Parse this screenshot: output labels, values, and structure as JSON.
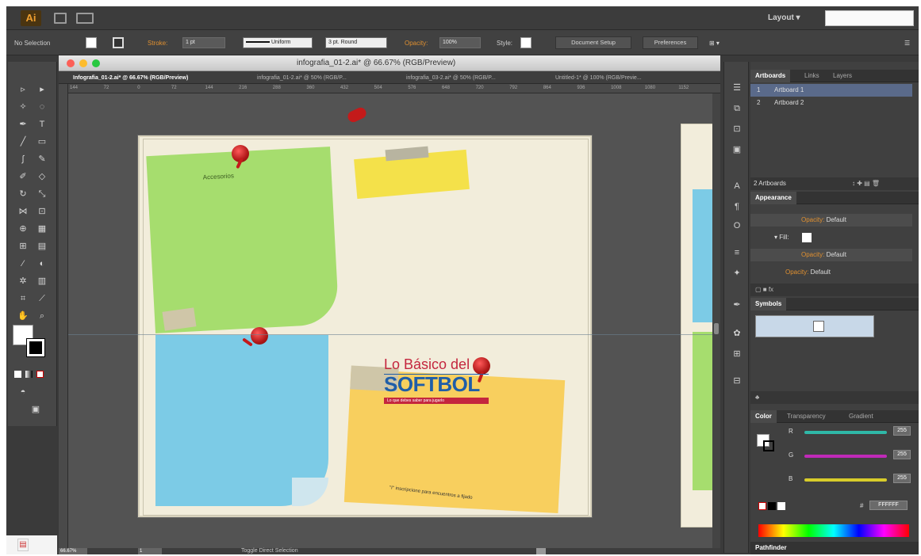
{
  "app": {
    "logo": "Ai",
    "workspace": "Layout"
  },
  "control_bar": {
    "selection": "No Selection",
    "stroke_label": "Stroke:",
    "stroke_weight": "1 pt",
    "stroke_profile": "Uniform",
    "brush": "3 pt. Round",
    "opacity_label": "Opacity:",
    "opacity_value": "100%",
    "style_label": "Style:",
    "document_setup": "Document Setup",
    "preferences": "Preferences"
  },
  "document": {
    "title": "infografia_01-2.ai* @ 66.67% (RGB/Preview)",
    "tabs": [
      "Infografia_01-2.ai* @ 66.67% (RGB/Preview)",
      "infografia_01-2.ai* @ 50% (RGB/P...",
      "infografia_03-2.ai* @ 50% (RGB/P...",
      "Untitled-1* @ 100% (RGB/Previe..."
    ],
    "ruler_ticks": [
      "144",
      "72",
      "0",
      "72",
      "144",
      "216",
      "288",
      "360",
      "432",
      "504",
      "576",
      "648",
      "720",
      "792",
      "864",
      "936",
      "1008",
      "1080",
      "1152"
    ]
  },
  "artboard": {
    "green_note_text": "Accesorios",
    "orange_note_text": "\"I\" inscripcione para encuentros a fijado",
    "logo_line1": "Lo Básico del",
    "logo_line2": "SOFTBOL",
    "logo_tagline": "Lo que debes saber para jugarlo"
  },
  "colors": {
    "green_note": "#a6dd6e",
    "yellow_note": "#f4e14a",
    "blue_note": "#7ccbe6",
    "orange_note": "#f8cf5e",
    "artboard": "#f2eddb",
    "pin": "#c41a1a",
    "logo_red": "#c4263e",
    "logo_blue": "#1f5ea8"
  },
  "status_bar": {
    "zoom": "66.67%",
    "page": "1",
    "status": "Toggle Direct Selection"
  },
  "panels": {
    "artboards_tabs": [
      "Artboards",
      "Links",
      "Layers"
    ],
    "artboards": [
      {
        "num": "1",
        "name": "Artboard 1"
      },
      {
        "num": "2",
        "name": "Artboard 2"
      }
    ],
    "artboards_count": "2 Artboards",
    "appearance_tab": "Appearance",
    "appearance_rows": [
      {
        "label": "Opacity:",
        "value": "Default"
      },
      {
        "label": "Fill:",
        "value": ""
      },
      {
        "label": "Opacity:",
        "value": "Default"
      },
      {
        "label": "Opacity:",
        "value": "Default"
      }
    ],
    "symbols_tab": "Symbols",
    "color_tabs": [
      "Color",
      "Transparency",
      "Gradient"
    ],
    "color_channels": [
      {
        "label": "R",
        "value": "255",
        "color": "#2fb8a8"
      },
      {
        "label": "G",
        "value": "255",
        "color": "#c02ab8"
      },
      {
        "label": "B",
        "value": "255",
        "color": "#d8cc2a"
      }
    ],
    "hex_label": "#",
    "hex_value": "FFFFFF",
    "pathfinder": "Pathfinder"
  }
}
